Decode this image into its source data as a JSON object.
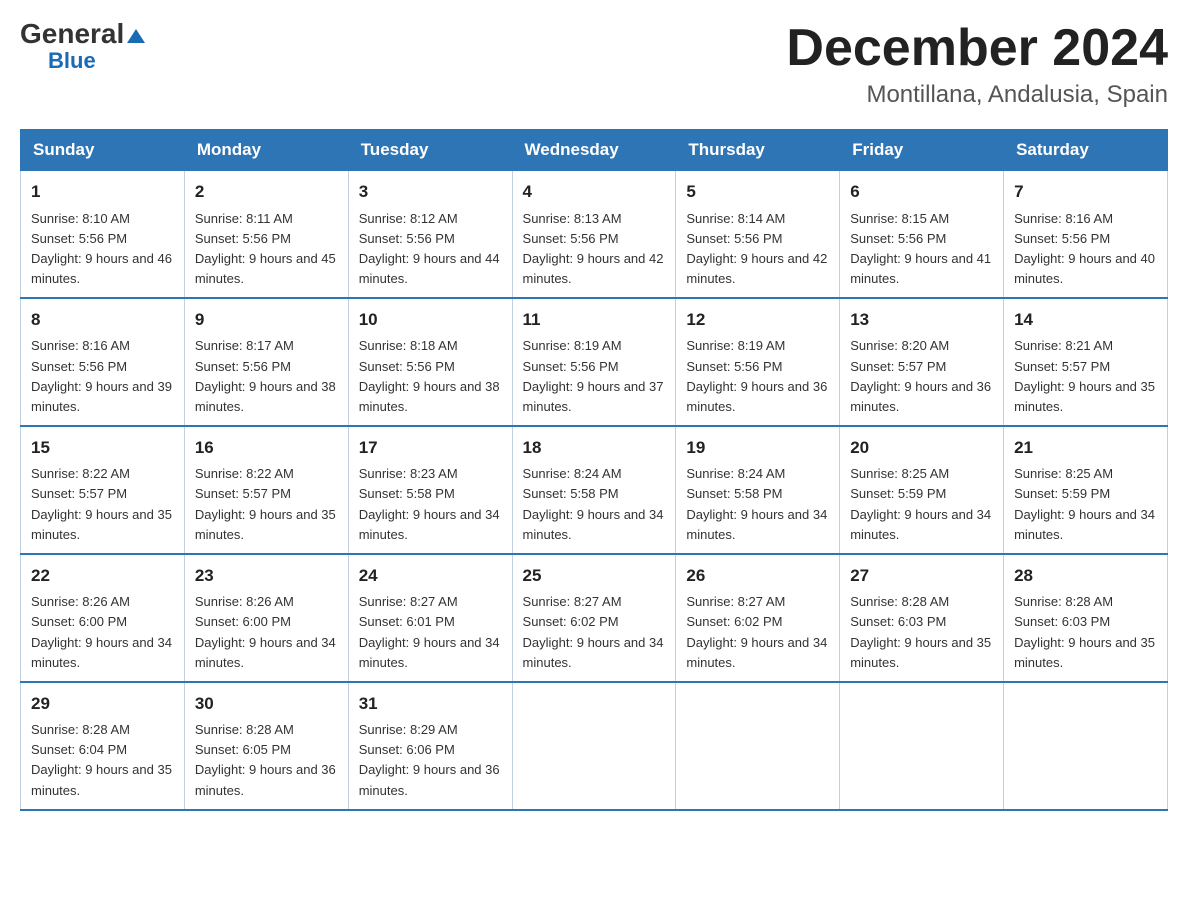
{
  "header": {
    "logo_general": "General",
    "logo_blue": "Blue",
    "month_title": "December 2024",
    "location": "Montillana, Andalusia, Spain"
  },
  "weekdays": [
    "Sunday",
    "Monday",
    "Tuesday",
    "Wednesday",
    "Thursday",
    "Friday",
    "Saturday"
  ],
  "weeks": [
    [
      {
        "day": "1",
        "sunrise": "8:10 AM",
        "sunset": "5:56 PM",
        "daylight": "9 hours and 46 minutes."
      },
      {
        "day": "2",
        "sunrise": "8:11 AM",
        "sunset": "5:56 PM",
        "daylight": "9 hours and 45 minutes."
      },
      {
        "day": "3",
        "sunrise": "8:12 AM",
        "sunset": "5:56 PM",
        "daylight": "9 hours and 44 minutes."
      },
      {
        "day": "4",
        "sunrise": "8:13 AM",
        "sunset": "5:56 PM",
        "daylight": "9 hours and 42 minutes."
      },
      {
        "day": "5",
        "sunrise": "8:14 AM",
        "sunset": "5:56 PM",
        "daylight": "9 hours and 42 minutes."
      },
      {
        "day": "6",
        "sunrise": "8:15 AM",
        "sunset": "5:56 PM",
        "daylight": "9 hours and 41 minutes."
      },
      {
        "day": "7",
        "sunrise": "8:16 AM",
        "sunset": "5:56 PM",
        "daylight": "9 hours and 40 minutes."
      }
    ],
    [
      {
        "day": "8",
        "sunrise": "8:16 AM",
        "sunset": "5:56 PM",
        "daylight": "9 hours and 39 minutes."
      },
      {
        "day": "9",
        "sunrise": "8:17 AM",
        "sunset": "5:56 PM",
        "daylight": "9 hours and 38 minutes."
      },
      {
        "day": "10",
        "sunrise": "8:18 AM",
        "sunset": "5:56 PM",
        "daylight": "9 hours and 38 minutes."
      },
      {
        "day": "11",
        "sunrise": "8:19 AM",
        "sunset": "5:56 PM",
        "daylight": "9 hours and 37 minutes."
      },
      {
        "day": "12",
        "sunrise": "8:19 AM",
        "sunset": "5:56 PM",
        "daylight": "9 hours and 36 minutes."
      },
      {
        "day": "13",
        "sunrise": "8:20 AM",
        "sunset": "5:57 PM",
        "daylight": "9 hours and 36 minutes."
      },
      {
        "day": "14",
        "sunrise": "8:21 AM",
        "sunset": "5:57 PM",
        "daylight": "9 hours and 35 minutes."
      }
    ],
    [
      {
        "day": "15",
        "sunrise": "8:22 AM",
        "sunset": "5:57 PM",
        "daylight": "9 hours and 35 minutes."
      },
      {
        "day": "16",
        "sunrise": "8:22 AM",
        "sunset": "5:57 PM",
        "daylight": "9 hours and 35 minutes."
      },
      {
        "day": "17",
        "sunrise": "8:23 AM",
        "sunset": "5:58 PM",
        "daylight": "9 hours and 34 minutes."
      },
      {
        "day": "18",
        "sunrise": "8:24 AM",
        "sunset": "5:58 PM",
        "daylight": "9 hours and 34 minutes."
      },
      {
        "day": "19",
        "sunrise": "8:24 AM",
        "sunset": "5:58 PM",
        "daylight": "9 hours and 34 minutes."
      },
      {
        "day": "20",
        "sunrise": "8:25 AM",
        "sunset": "5:59 PM",
        "daylight": "9 hours and 34 minutes."
      },
      {
        "day": "21",
        "sunrise": "8:25 AM",
        "sunset": "5:59 PM",
        "daylight": "9 hours and 34 minutes."
      }
    ],
    [
      {
        "day": "22",
        "sunrise": "8:26 AM",
        "sunset": "6:00 PM",
        "daylight": "9 hours and 34 minutes."
      },
      {
        "day": "23",
        "sunrise": "8:26 AM",
        "sunset": "6:00 PM",
        "daylight": "9 hours and 34 minutes."
      },
      {
        "day": "24",
        "sunrise": "8:27 AM",
        "sunset": "6:01 PM",
        "daylight": "9 hours and 34 minutes."
      },
      {
        "day": "25",
        "sunrise": "8:27 AM",
        "sunset": "6:02 PM",
        "daylight": "9 hours and 34 minutes."
      },
      {
        "day": "26",
        "sunrise": "8:27 AM",
        "sunset": "6:02 PM",
        "daylight": "9 hours and 34 minutes."
      },
      {
        "day": "27",
        "sunrise": "8:28 AM",
        "sunset": "6:03 PM",
        "daylight": "9 hours and 35 minutes."
      },
      {
        "day": "28",
        "sunrise": "8:28 AM",
        "sunset": "6:03 PM",
        "daylight": "9 hours and 35 minutes."
      }
    ],
    [
      {
        "day": "29",
        "sunrise": "8:28 AM",
        "sunset": "6:04 PM",
        "daylight": "9 hours and 35 minutes."
      },
      {
        "day": "30",
        "sunrise": "8:28 AM",
        "sunset": "6:05 PM",
        "daylight": "9 hours and 36 minutes."
      },
      {
        "day": "31",
        "sunrise": "8:29 AM",
        "sunset": "6:06 PM",
        "daylight": "9 hours and 36 minutes."
      },
      null,
      null,
      null,
      null
    ]
  ]
}
